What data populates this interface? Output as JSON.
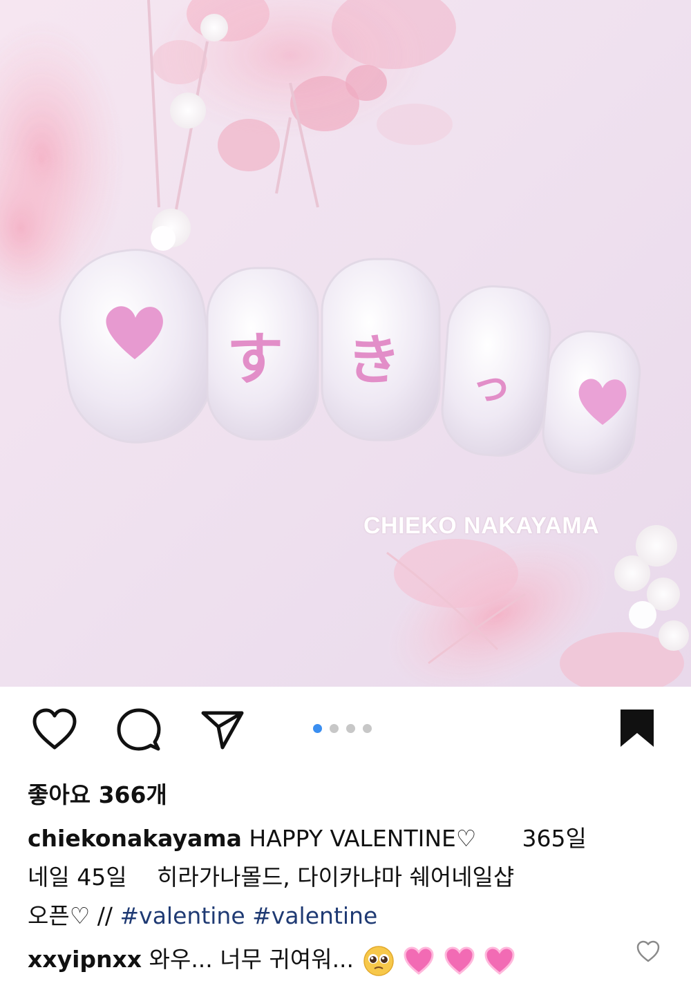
{
  "post": {
    "watermark": "CHIEKO NAKAYAMA",
    "carousel": {
      "count": 4,
      "active_index": 0
    },
    "likes_text": "좋아요 366개",
    "caption": {
      "username": "chiekonakayama",
      "line1_text": "HAPPY VALENTINE♡　　365일",
      "line2_text": "네일 45일　 히라가나몰드, 다이카냐마 쉐어네일샵",
      "line3_text": "오픈♡ //",
      "hashtags": [
        "#valentine",
        "#valentine"
      ]
    },
    "comment": {
      "username": "xxyipnxx",
      "text": "와우... 너무 귀여워..."
    }
  },
  "icons": {
    "like": "heart-outline-icon",
    "comment": "speech-bubble-icon",
    "share": "paper-plane-icon",
    "save": "bookmark-filled-icon",
    "comment_like": "heart-outline-icon"
  },
  "colors": {
    "hashtag": "#1f3a73",
    "carousel_active": "#3a8ef0",
    "carousel_inactive": "#c7c7c7",
    "photo_background": "#f1e3ee",
    "nail_decoration": "#e79ad0"
  }
}
